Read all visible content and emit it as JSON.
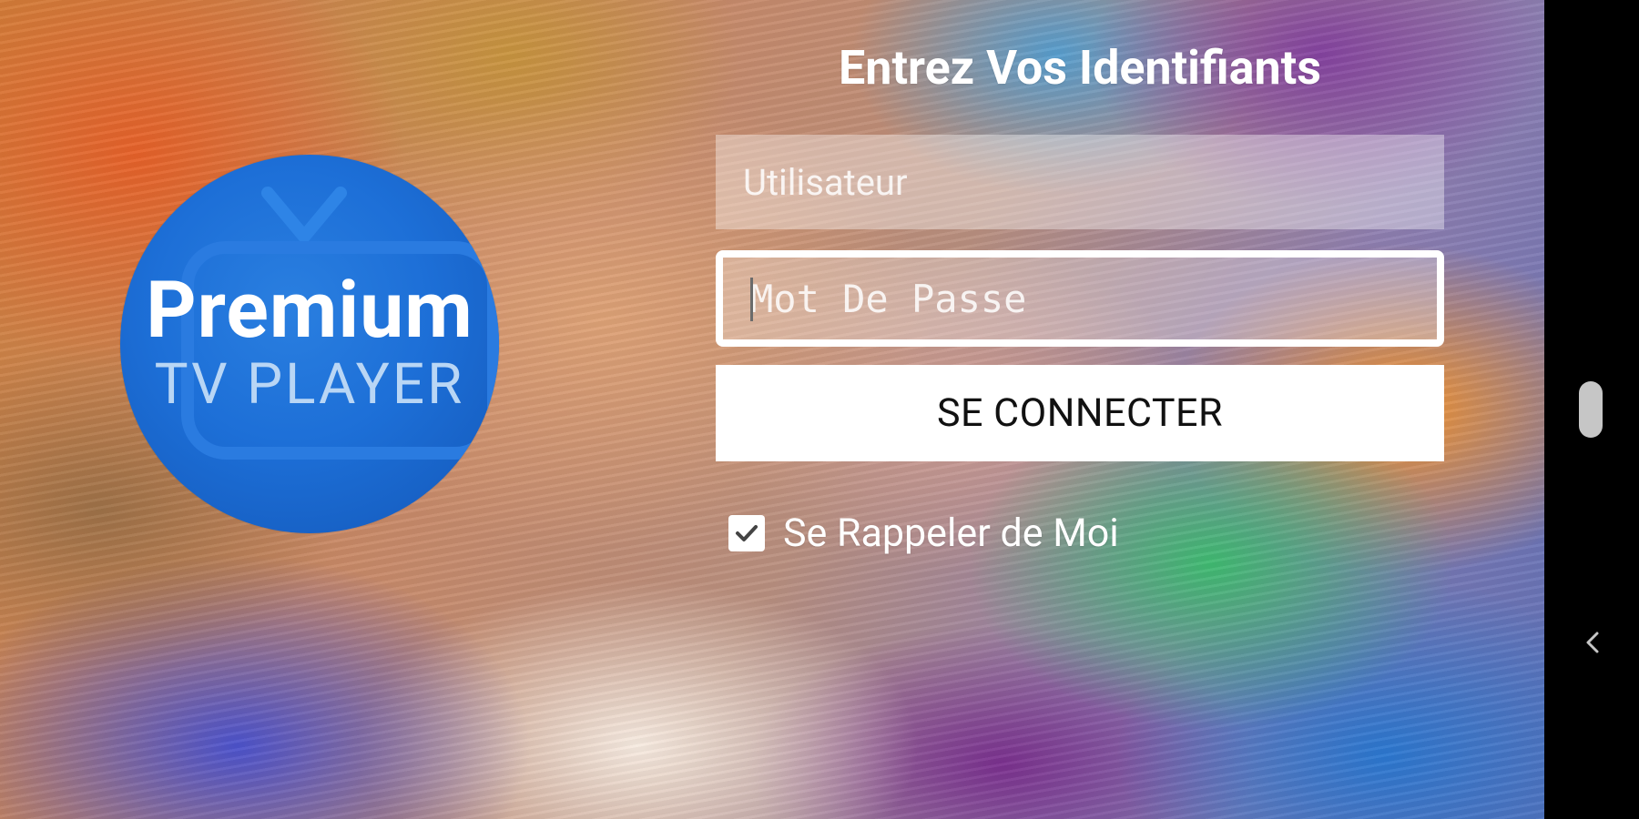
{
  "app": {
    "logo_text_main": "Premium",
    "logo_text_sub": "TV PLAYER"
  },
  "login": {
    "title": "Entrez Vos Identifiants",
    "username_placeholder": "Utilisateur",
    "password_placeholder": "Mot De Passe",
    "submit_label": "SE CONNECTER",
    "remember_label": "Se Rappeler de Moi",
    "remember_checked": true
  },
  "colors": {
    "logo_blue": "#1d6fd7",
    "button_bg": "#ffffff",
    "text_white": "#ffffff"
  },
  "icons": {
    "checkbox": "checkmark-icon",
    "nav_back": "chevron-left-icon"
  }
}
